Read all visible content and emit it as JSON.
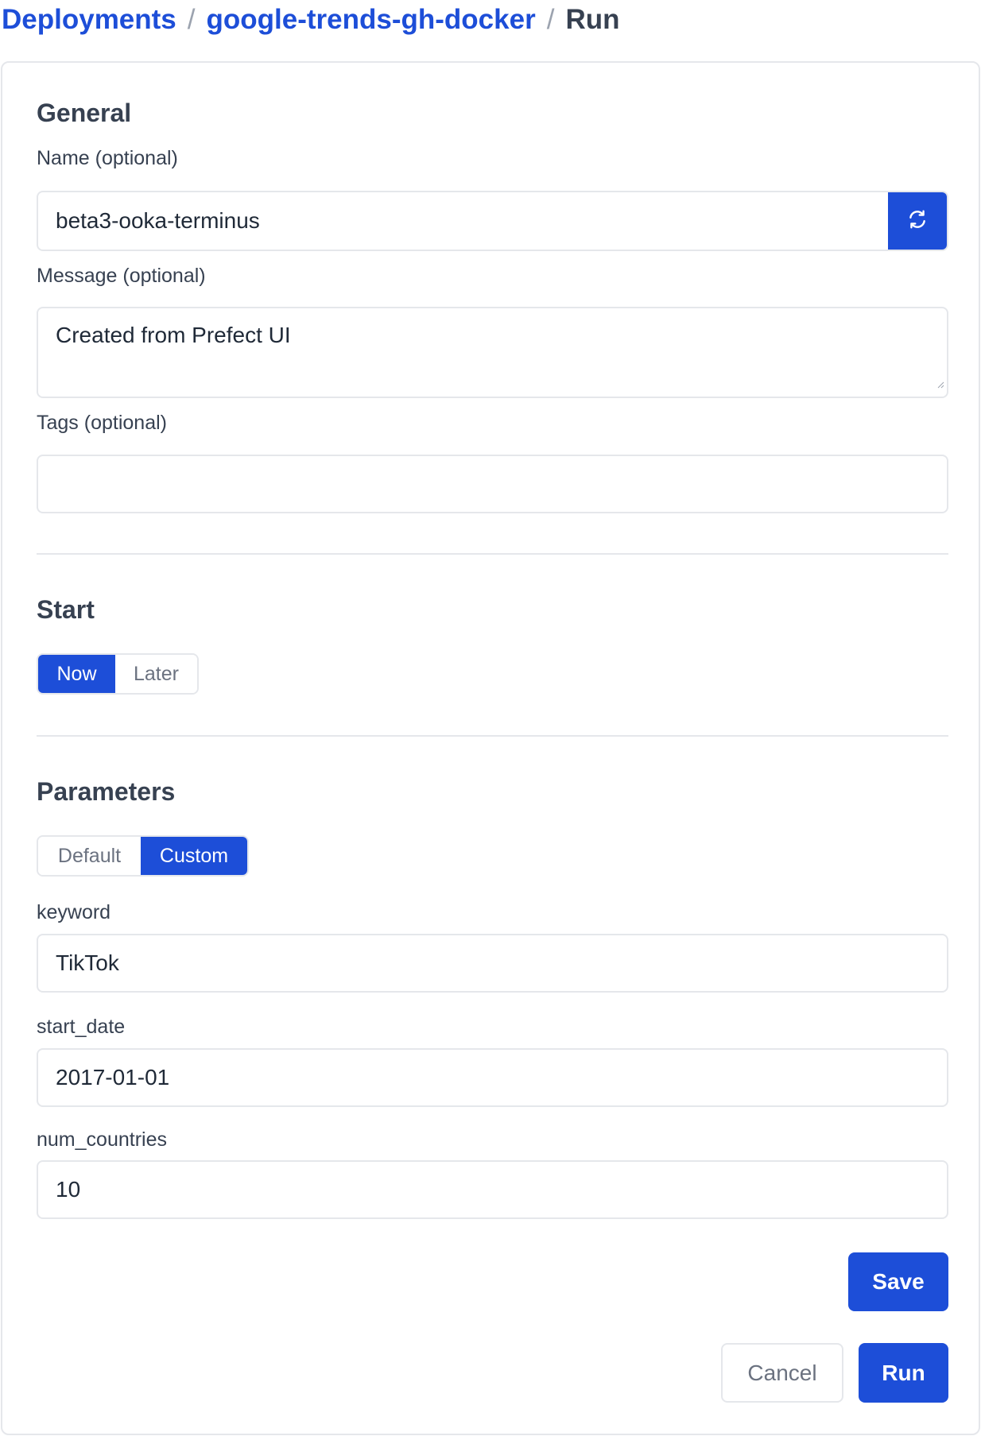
{
  "breadcrumb": {
    "items": [
      "Deployments",
      "google-trends-gh-docker"
    ],
    "separator": "/",
    "current": "Run"
  },
  "general": {
    "title": "General",
    "name": {
      "label": "Name (optional)",
      "value": "beta3-ooka-terminus",
      "icon": "refresh-icon"
    },
    "message": {
      "label": "Message (optional)",
      "value": "Created from Prefect UI"
    },
    "tags": {
      "label": "Tags (optional)",
      "value": ""
    }
  },
  "start": {
    "title": "Start",
    "options": [
      "Now",
      "Later"
    ],
    "selected": "Now"
  },
  "parameters": {
    "title": "Parameters",
    "options": [
      "Default",
      "Custom"
    ],
    "selected": "Custom",
    "fields": [
      {
        "label": "keyword",
        "value": "TikTok"
      },
      {
        "label": "start_date",
        "value": "2017-01-01"
      },
      {
        "label": "num_countries",
        "value": "10"
      }
    ]
  },
  "actions": {
    "save_label": "Save",
    "cancel_label": "Cancel",
    "run_label": "Run"
  },
  "colors": {
    "accent": "#1d4ed8",
    "border": "#e5e7eb",
    "text": "#374151",
    "muted": "#6b7280"
  }
}
